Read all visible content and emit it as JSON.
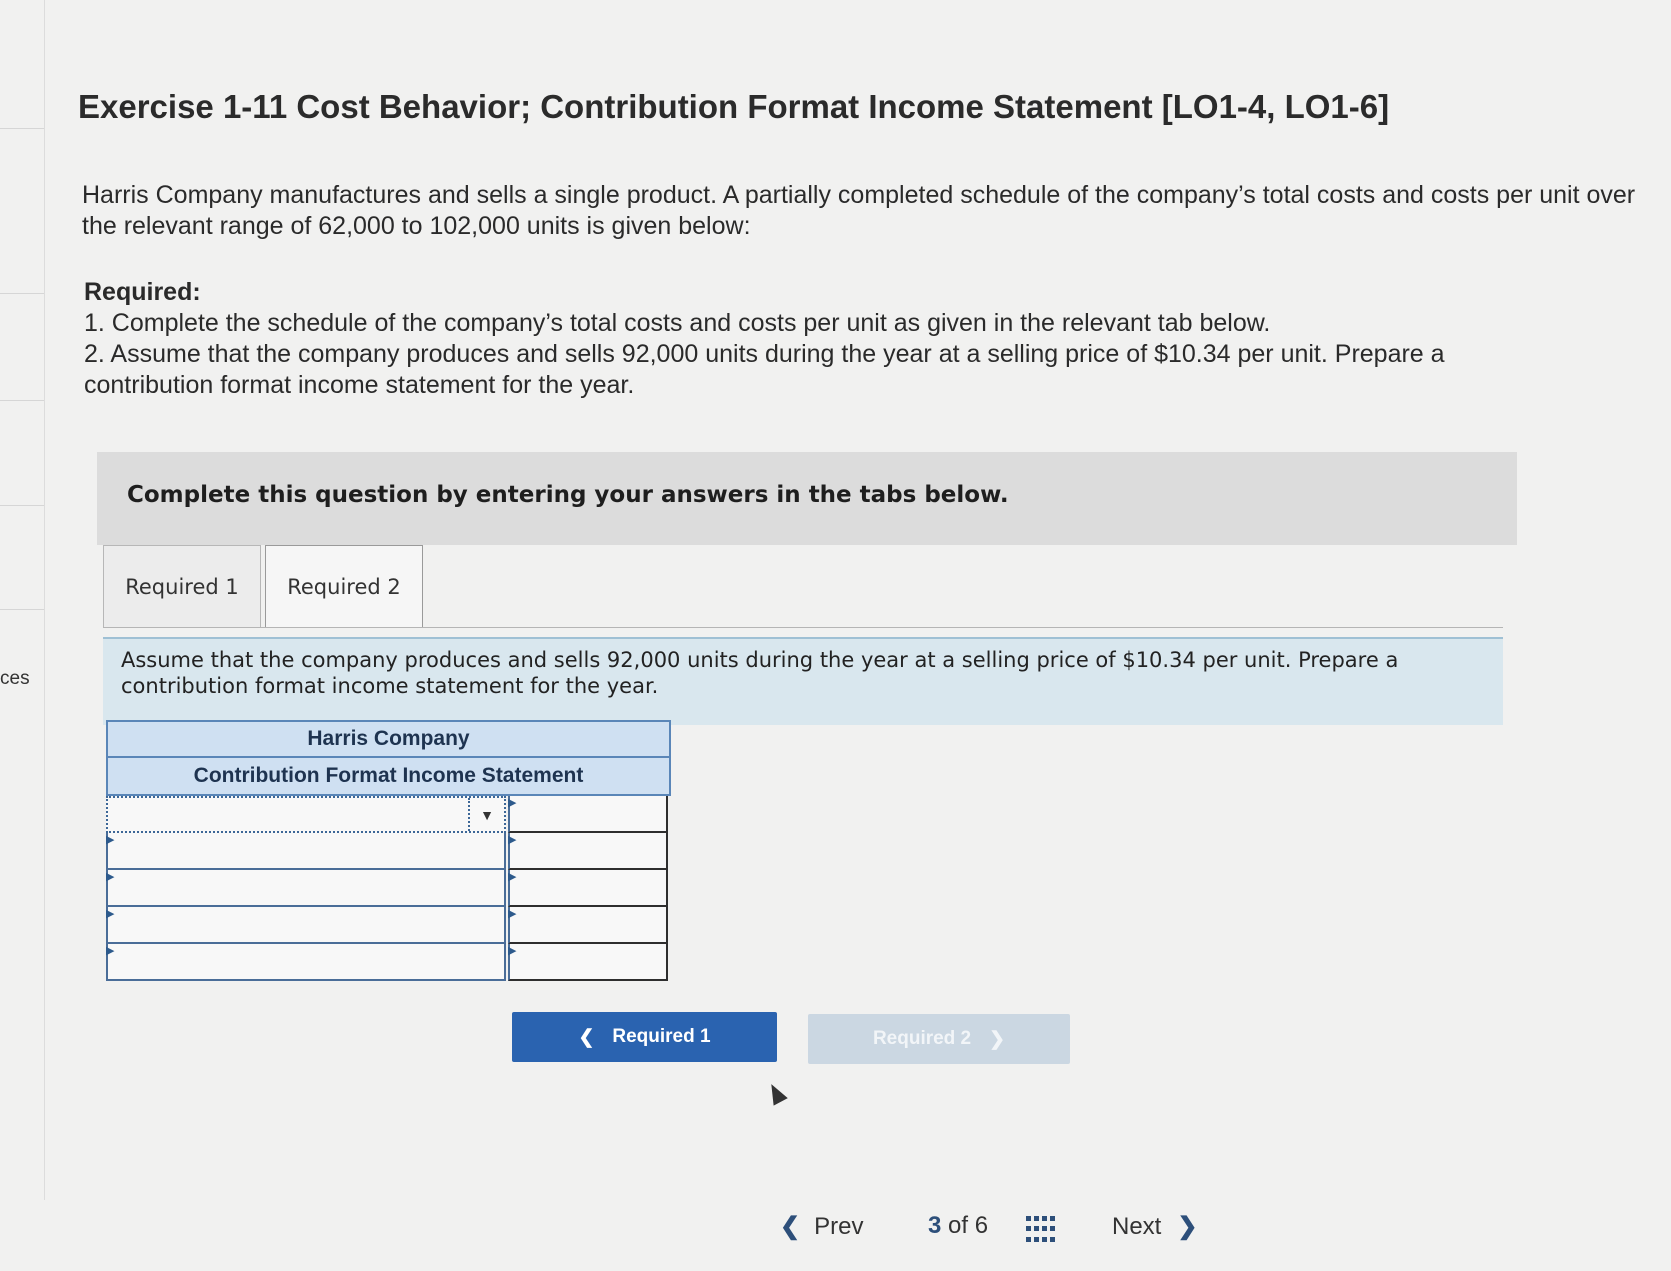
{
  "left_rail": {
    "label": "ces"
  },
  "title": "Exercise 1-11 Cost Behavior; Contribution Format Income Statement [LO1-4, LO1-6]",
  "intro": "Harris Company manufactures and sells a single product. A partially completed schedule of the company’s total costs and costs per unit over the relevant range of 62,000 to 102,000 units is given below:",
  "required": {
    "heading": "Required:",
    "items": [
      "1. Complete the schedule of the company’s total costs and costs per unit as given in the relevant tab below.",
      "2. Assume that the company produces and sells 92,000 units during the year at a selling price of $10.34 per unit. Prepare a contribution format income statement for the year."
    ]
  },
  "instruction": "Complete this question by entering your answers in the tabs below.",
  "tabs": [
    {
      "label": "Required 1",
      "active": false
    },
    {
      "label": "Required 2",
      "active": true
    }
  ],
  "panel_prompt": "Assume that the company produces and sells 92,000 units during the year at a selling price of $10.34 per unit. Prepare a contribution format income statement for the year.",
  "statement": {
    "company": "Harris Company",
    "title": "Contribution Format Income Statement",
    "rows": [
      {
        "label": "",
        "value": ""
      },
      {
        "label": "",
        "value": ""
      },
      {
        "label": "",
        "value": ""
      },
      {
        "label": "",
        "value": ""
      },
      {
        "label": "",
        "value": ""
      }
    ]
  },
  "nav_buttons": {
    "prev_label": "Required 1",
    "next_label": "Required 2"
  },
  "pager": {
    "prev": "Prev",
    "current": "3",
    "of_text": "of",
    "total": "6",
    "next": "Next"
  },
  "colors": {
    "primary_button": "#2a63b0",
    "disabled_button": "#cbd7e2",
    "panel_background": "#d9e7ee",
    "statement_header": "#cfe0f2"
  }
}
